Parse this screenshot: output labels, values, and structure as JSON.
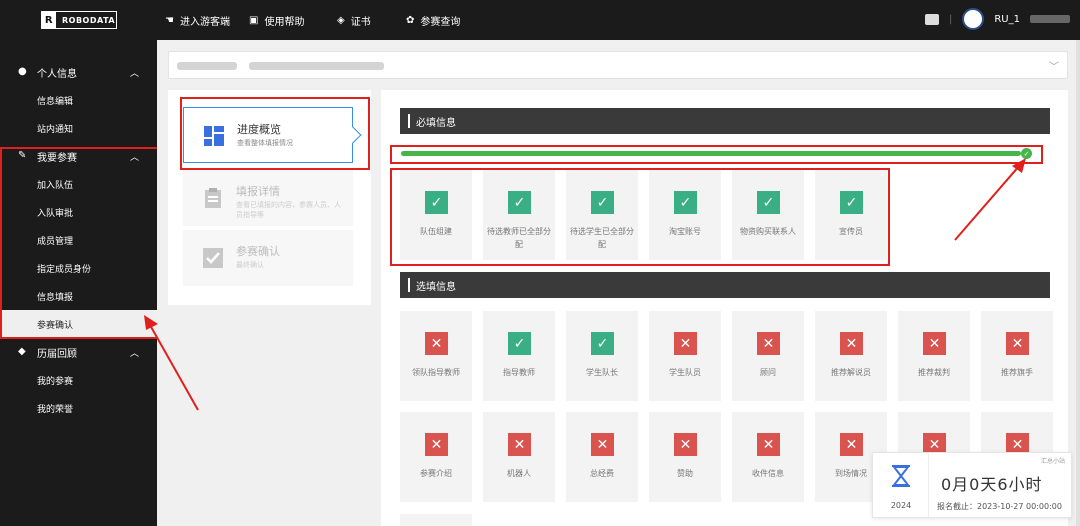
{
  "brand": {
    "mark": "R",
    "name": "ROBODATA"
  },
  "topnav": [
    {
      "icon": "cursor-icon",
      "label": "进入游客端"
    },
    {
      "icon": "book-icon",
      "label": "使用帮助"
    },
    {
      "icon": "certificate-icon",
      "label": "证书"
    },
    {
      "icon": "star-icon",
      "label": "参赛查询"
    }
  ],
  "user": {
    "name": "RU_1"
  },
  "sidebar": {
    "groups": [
      {
        "label": "个人信息",
        "icon": "user-icon",
        "items": [
          "信息编辑",
          "站内通知"
        ]
      },
      {
        "label": "我要参赛",
        "icon": "pencil-icon",
        "items": [
          "加入队伍",
          "入队审批",
          "成员管理",
          "指定成员身份",
          "信息填报",
          "参赛确认"
        ]
      },
      {
        "label": "历届回顾",
        "icon": "cube-icon",
        "items": [
          "我的参赛",
          "我的荣誉"
        ]
      }
    ],
    "active_item": "参赛确认"
  },
  "steps": [
    {
      "title": "进度概览",
      "sub": "查看整体填报情况",
      "icon": "dashboard-icon",
      "active": true
    },
    {
      "title": "填报详情",
      "sub": "查看已填报的内容，参赛人员、人员指导等",
      "icon": "clipboard-icon",
      "active": false
    },
    {
      "title": "参赛确认",
      "sub": "最终确认",
      "icon": "checkbox-icon",
      "active": false
    }
  ],
  "required": {
    "title": "必填信息",
    "progress_percent": 100,
    "items": [
      {
        "label": "队伍组建",
        "done": true
      },
      {
        "label": "待选教师已全部分配",
        "done": true
      },
      {
        "label": "待选学生已全部分配",
        "done": true
      },
      {
        "label": "淘宝账号",
        "done": true
      },
      {
        "label": "物资购买联系人",
        "done": true
      },
      {
        "label": "宣传员",
        "done": true
      }
    ]
  },
  "optional": {
    "title": "选填信息",
    "items": [
      {
        "label": "领队指导教师",
        "done": false
      },
      {
        "label": "指导教师",
        "done": true
      },
      {
        "label": "学生队长",
        "done": true
      },
      {
        "label": "学生队员",
        "done": false
      },
      {
        "label": "顾问",
        "done": false
      },
      {
        "label": "推荐解说员",
        "done": false
      },
      {
        "label": "推荐裁判",
        "done": false
      },
      {
        "label": "推荐旗手",
        "done": false
      },
      {
        "label": "参赛介绍",
        "done": false
      },
      {
        "label": "机器人",
        "done": false
      },
      {
        "label": "总经费",
        "done": false
      },
      {
        "label": "赞助",
        "done": false
      },
      {
        "label": "收件信息",
        "done": false
      },
      {
        "label": "到场情况",
        "done": false
      },
      {
        "label": "",
        "done": false
      },
      {
        "label": "",
        "done": false
      }
    ]
  },
  "countdown": {
    "time": "0月0天6小时",
    "year": "2024",
    "deadline": "报名截止：2023-10-27 00:00:00",
    "tag": "汇总小站"
  },
  "colors": {
    "ok": "#3aaf86",
    "no": "#d9534f",
    "highlight": "#e0201c",
    "accent": "#3a8ee6"
  }
}
